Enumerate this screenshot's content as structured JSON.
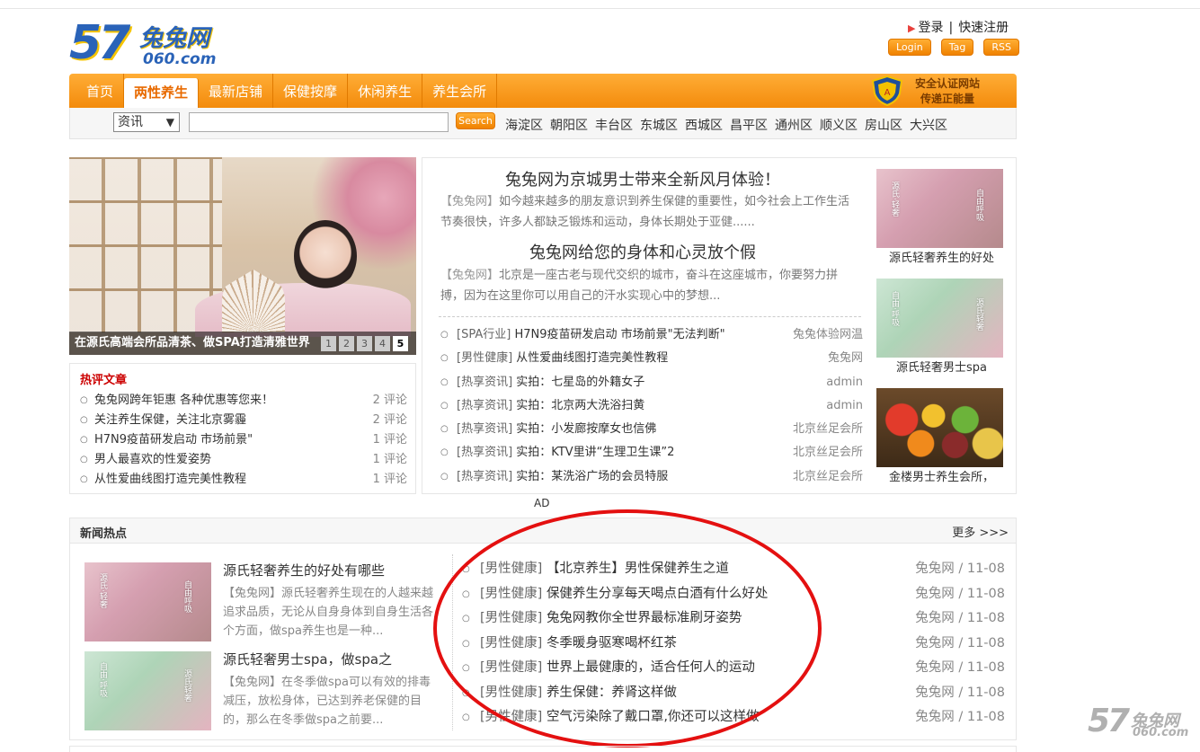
{
  "logo": {
    "number": "57",
    "name": "兔兔网",
    "domain": "060.com"
  },
  "user": {
    "login": "登录",
    "sep": "|",
    "register": "快速注册"
  },
  "mini_buttons": [
    "Login",
    "Tag",
    "RSS"
  ],
  "nav": {
    "items": [
      "首页",
      "两性养生",
      "最新店铺",
      "保健按摩",
      "休闲养生",
      "养生会所"
    ],
    "active": 1
  },
  "badge": {
    "line1": "安全认证网站",
    "line2": "传递正能量"
  },
  "search": {
    "category": "资讯",
    "value": "",
    "button": "Search"
  },
  "districts": [
    "海淀区",
    "朝阳区",
    "丰台区",
    "东城区",
    "西城区",
    "昌平区",
    "通州区",
    "顺义区",
    "房山区",
    "大兴区"
  ],
  "slider": {
    "caption": "在源氏高端会所品清茶、做SPA打造清雅世界",
    "pages": [
      "1",
      "2",
      "3",
      "4",
      "5"
    ],
    "active_page": 4
  },
  "hot": {
    "title": "热评文章",
    "items": [
      {
        "title": "兔兔网跨年钜惠 各种优惠等您来！",
        "count": "2 评论"
      },
      {
        "title": "关注养生保健，关注北京雾霾",
        "count": "2 评论"
      },
      {
        "title": "H7N9疫苗研发启动 市场前景\"",
        "count": "1 评论"
      },
      {
        "title": "男人最喜欢的性爱姿势",
        "count": "1 评论"
      },
      {
        "title": "从性爱曲线图打造完美性教程",
        "count": "1 评论"
      }
    ]
  },
  "headlines": [
    {
      "title": "兔兔网为京城男士带来全新风月体验！",
      "source": "【兔兔网】",
      "excerpt": "如今越来越多的朋友意识到养生保健的重要性，如今社会上工作生活节奏很快，许多人都缺乏锻炼和运动，身体长期处于亚健......"
    },
    {
      "title": "兔兔网给您的身体和心灵放个假",
      "source": "【兔兔网】",
      "excerpt": "北京是一座古老与现代交织的城市，奋斗在这座城市，你要努力拼搏，因为在这里你可以用自己的汗水实现心中的梦想..."
    }
  ],
  "center_news": [
    {
      "tag": "[SPA行业]",
      "title": "H7N9疫苗研发启动 市场前景\"无法判断\"",
      "by": "兔兔体验网温"
    },
    {
      "tag": "[男性健康]",
      "title": "从性爱曲线图打造完美性教程",
      "by": "兔兔网"
    },
    {
      "tag": "[热享资讯]",
      "title": "实拍：七星岛的外籍女子",
      "by": "admin"
    },
    {
      "tag": "[热享资讯]",
      "title": "实拍：北京两大洗浴扫黄",
      "by": "admin"
    },
    {
      "tag": "[热享资讯]",
      "title": "实拍：小发廊按摩女也信佛",
      "by": "北京丝足会所"
    },
    {
      "tag": "[热享资讯]",
      "title": "实拍：KTV里讲“生理卫生课”2",
      "by": "北京丝足会所"
    },
    {
      "tag": "[热享资讯]",
      "title": "实拍：某洗浴广场的会员特服",
      "by": "北京丝足会所"
    }
  ],
  "thumbs": [
    {
      "caption": "源氏轻奢养生的好处",
      "image": "pink-portrait"
    },
    {
      "caption": "源氏轻奢男士spa",
      "image": "green-portrait"
    },
    {
      "caption": "金楼男士养生会所，",
      "image": "fruit-basket"
    }
  ],
  "ad": "AD",
  "news_hot": {
    "title": "新闻热点",
    "more": "更多 >>>",
    "features": [
      {
        "title": "源氏轻奢养生的好处有哪些",
        "source": "【兔兔网】",
        "excerpt": "源氏轻奢养生现在的人越来越追求品质，无论从自身身体到自身生活各个方面，做spa养生也是一种..."
      },
      {
        "title": "源氏轻奢男士spa，做spa之",
        "source": "【兔兔网】",
        "excerpt": "在冬季做spa可以有效的排毒减压，放松身体，已达到养老保健的目的，那么在冬季做spa之前要..."
      }
    ],
    "list": [
      {
        "tag": "[男性健康]",
        "title": "【北京养生】男性保健养生之道",
        "meta": "兔兔网 / 11-08"
      },
      {
        "tag": "[男性健康]",
        "title": "保健养生分享每天喝点白酒有什么好处",
        "meta": "兔兔网 / 11-08"
      },
      {
        "tag": "[男性健康]",
        "title": "兔兔网教你全世界最标准刷牙姿势",
        "meta": "兔兔网 / 11-08"
      },
      {
        "tag": "[男性健康]",
        "title": "冬季暖身驱寒喝杯红茶",
        "meta": "兔兔网 / 11-08"
      },
      {
        "tag": "[男性健康]",
        "title": "世界上最健康的，适合任何人的运动",
        "meta": "兔兔网 / 11-08"
      },
      {
        "tag": "[男性健康]",
        "title": "养生保健：养肾这样做",
        "meta": "兔兔网 / 11-08"
      },
      {
        "tag": "[男性健康]",
        "title": "空气污染除了戴口罩,你还可以这样做",
        "meta": "兔兔网 / 11-08"
      }
    ]
  },
  "watermark": {
    "number": "57",
    "name": "兔兔网",
    "domain": "060.com"
  },
  "colors": {
    "accent": "#f38b0c",
    "annotation": "#e41010",
    "link": "#333333"
  }
}
